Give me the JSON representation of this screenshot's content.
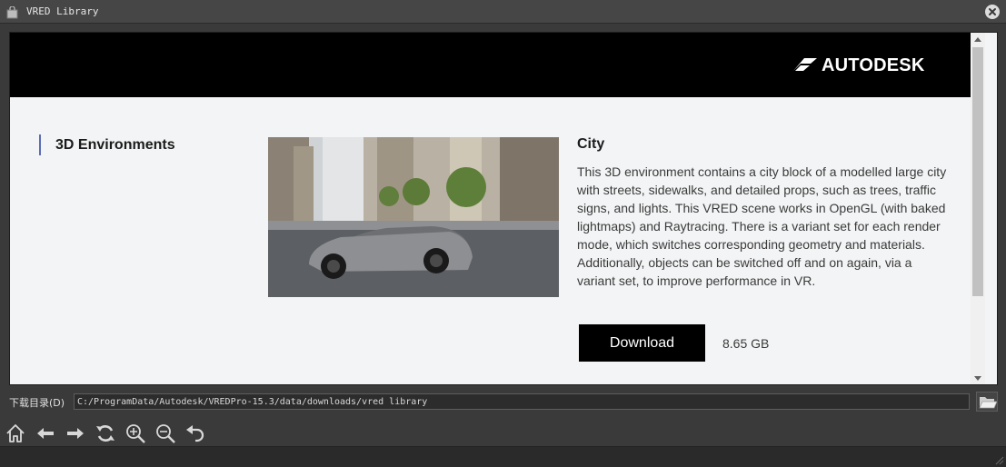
{
  "window": {
    "title": "VRED Library",
    "app_icon": "library-bag-icon",
    "close_icon": "close-icon"
  },
  "header": {
    "brand": "AUTODESK",
    "logo_icon": "autodesk-logo-icon",
    "background": "#000000"
  },
  "sidebar": {
    "category": "3D Environments",
    "accent": "#5a6db5"
  },
  "item": {
    "thumbnail": "city-street-sports-car-image",
    "title": "City",
    "description": "This 3D environment contains a city block of a modelled large city with streets, sidewalks, and detailed props, such as trees, traffic signs, and lights. This VRED scene works in OpenGL (with baked lightmaps) and Raytracing. There is a variant set for each render mode, which switches corresponding geometry and materials. Additionally, objects can be switched off and on again, via a variant set, to improve performance in VR.",
    "download_label": "Download",
    "size": "8.65 GB"
  },
  "path": {
    "label": "下载目录(D)",
    "value": "C:/ProgramData/Autodesk/VREDPro-15.3/data/downloads/vred library",
    "browse_icon": "open-folder-icon"
  },
  "toolbar": {
    "icons": [
      "home-icon",
      "back-arrow-icon",
      "forward-arrow-icon",
      "refresh-icon",
      "zoom-in-icon",
      "zoom-out-icon",
      "undo-icon"
    ]
  }
}
